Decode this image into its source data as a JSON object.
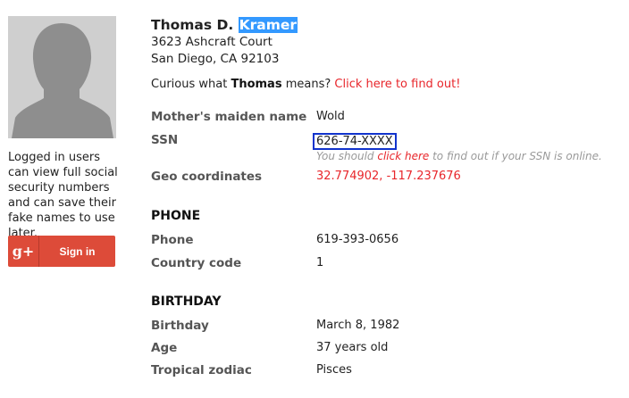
{
  "avatar": {
    "icon": "person-silhouette-icon"
  },
  "sidebar": {
    "login_note": "Logged in users can view full social security numbers and can save their fake names to use later.",
    "signin": {
      "icon_text": "g+",
      "label": "Sign in",
      "color": "#dd4b39"
    }
  },
  "person": {
    "first": "Thomas D.",
    "last": "Kramer",
    "address_line1": "3623 Ashcraft Court",
    "address_line2": "San Diego, CA 92103"
  },
  "curious": {
    "prefix": "Curious what ",
    "name": "Thomas",
    "suffix": " means?",
    "link": "Click here to find out!"
  },
  "details": {
    "maiden_label": "Mother's maiden name",
    "maiden_value": "Wold",
    "ssn_label": "SSN",
    "ssn_value": "626-74-XXXX",
    "ssn_note_pre": "You should ",
    "ssn_note_link": "click here",
    "ssn_note_post": " to find out if your SSN is online.",
    "geo_label": "Geo coordinates",
    "geo_value": "32.774902, -117.237676"
  },
  "phone": {
    "heading": "PHONE",
    "phone_label": "Phone",
    "phone_value": "619-393-0656",
    "cc_label": "Country code",
    "cc_value": "1"
  },
  "birthday": {
    "heading": "BIRTHDAY",
    "bday_label": "Birthday",
    "bday_value": "March 8, 1982",
    "age_label": "Age",
    "age_value": "37 years old",
    "zodiac_label": "Tropical zodiac",
    "zodiac_value": "Pisces"
  },
  "colors": {
    "accent_red": "#e8262b",
    "highlight": "#3399ff",
    "ssn_box": "#1133cc"
  }
}
